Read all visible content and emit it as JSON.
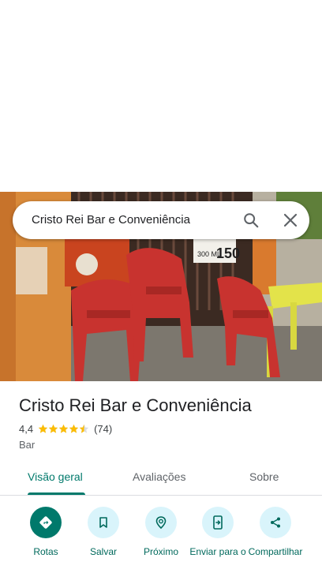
{
  "search": {
    "query": "Cristo Rei Bar e Conveniência"
  },
  "photo": {
    "sign_text": "150",
    "menu_text": "300 ML"
  },
  "place": {
    "title": "Cristo Rei Bar e Conveniência",
    "rating": "4,4",
    "stars": 4.5,
    "review_count": "(74)",
    "category": "Bar"
  },
  "tabs": [
    {
      "label": "Visão geral",
      "active": true
    },
    {
      "label": "Avaliações",
      "active": false
    },
    {
      "label": "Sobre",
      "active": false
    }
  ],
  "actions": [
    {
      "label": "Rotas",
      "icon": "directions-icon"
    },
    {
      "label": "Salvar",
      "icon": "bookmark-icon"
    },
    {
      "label": "Próximo",
      "icon": "nearby-icon"
    },
    {
      "label": "Enviar para o",
      "icon": "send-to-phone-icon"
    },
    {
      "label": "Compartilhar",
      "icon": "share-icon"
    }
  ],
  "colors": {
    "accent": "#00796b",
    "action_bg": "#d9f4fb",
    "star": "#fbbc04"
  }
}
